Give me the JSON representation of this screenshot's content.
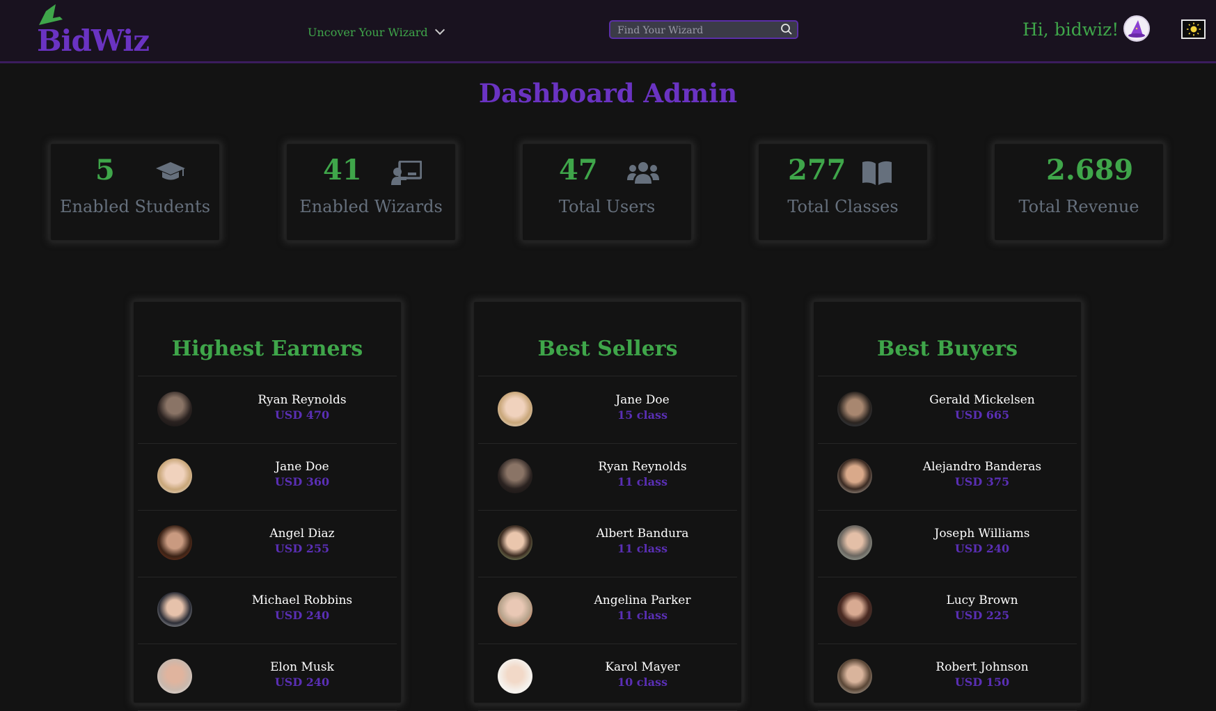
{
  "navbar": {
    "logo_text": "BidWiz",
    "dropdown_label": "Uncover Your Wizard",
    "search_placeholder": "Find Your Wizard",
    "greeting": "Hi, bidwiz!"
  },
  "page_title": "Dashboard Admin",
  "stats": [
    {
      "value": "5",
      "label": "Enabled Students",
      "icon": "graduation-cap-icon"
    },
    {
      "value": "41",
      "label": "Enabled Wizards",
      "icon": "chalkboard-teacher-icon"
    },
    {
      "value": "47",
      "label": "Total Users",
      "icon": "users-icon"
    },
    {
      "value": "277",
      "label": "Total Classes",
      "icon": "book-open-icon"
    },
    {
      "value": "2.689",
      "label": "Total Revenue",
      "icon": ""
    }
  ],
  "panels": [
    {
      "title": "Highest Earners",
      "rows": [
        {
          "name": "Ryan Reynolds",
          "value": "USD 470"
        },
        {
          "name": "Jane Doe",
          "value": "USD 360"
        },
        {
          "name": "Angel Diaz",
          "value": "USD 255"
        },
        {
          "name": "Michael Robbins",
          "value": "USD 240"
        },
        {
          "name": "Elon Musk",
          "value": "USD 240"
        }
      ]
    },
    {
      "title": "Best Sellers",
      "rows": [
        {
          "name": "Jane Doe",
          "value": "15 class"
        },
        {
          "name": "Ryan Reynolds",
          "value": "11 class"
        },
        {
          "name": "Albert Bandura",
          "value": "11 class"
        },
        {
          "name": "Angelina Parker",
          "value": "11 class"
        },
        {
          "name": "Karol Mayer",
          "value": "10 class"
        }
      ]
    },
    {
      "title": "Best Buyers",
      "rows": [
        {
          "name": "Gerald Mickelsen",
          "value": "USD 665"
        },
        {
          "name": "Alejandro Banderas",
          "value": "USD 375"
        },
        {
          "name": "Joseph Williams",
          "value": "USD 240"
        },
        {
          "name": "Lucy Brown",
          "value": "USD 225"
        },
        {
          "name": "Robert Johnson",
          "value": "USD 150"
        }
      ]
    }
  ],
  "colors": {
    "accent_green": "#3fa64a",
    "accent_purple": "#6a33c2",
    "value_purple": "#5a2fb5",
    "background": "#131313"
  }
}
